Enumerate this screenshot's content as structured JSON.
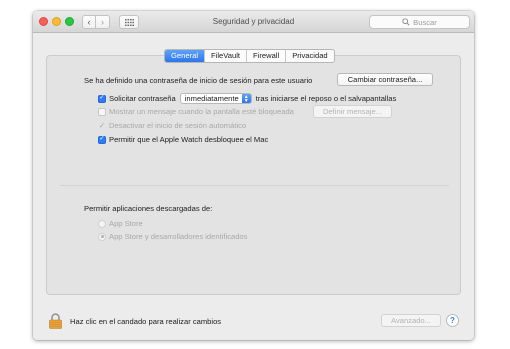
{
  "window": {
    "title": "Seguridad y privacidad"
  },
  "toolbar": {
    "back_icon": "chevron-left-icon",
    "forward_icon": "chevron-right-icon",
    "grid_icon": "show-all-grid-icon",
    "search_placeholder": "Buscar"
  },
  "tabs": [
    {
      "label": "General",
      "active": true
    },
    {
      "label": "FileVault",
      "active": false
    },
    {
      "label": "Firewall",
      "active": false
    },
    {
      "label": "Privacidad",
      "active": false
    }
  ],
  "general": {
    "password_set_text": "Se ha definido una contraseña de inicio de sesión para este usuario",
    "change_password_button": "Cambiar contraseña...",
    "require_password": {
      "label": "Solicitar contraseña",
      "checked": true,
      "popup_value": "inmediatamente",
      "suffix": "tras iniciarse el reposo o el salvapantallas"
    },
    "show_message": {
      "label": "Mostrar un mensaje cuando la pantalla esté bloqueada",
      "checked": false,
      "enabled": false,
      "button": "Definir mensaje..."
    },
    "disable_autologin": {
      "label": "Desactivar el inicio de sesión automático",
      "checked": true,
      "enabled": false
    },
    "apple_watch": {
      "label": "Permitir que el Apple Watch desbloquee el Mac",
      "checked": true
    }
  },
  "downloads": {
    "heading": "Permitir aplicaciones descargadas de:",
    "options": [
      {
        "label": "App Store",
        "selected": false
      },
      {
        "label": "App Store y desarrolladores identificados",
        "selected": true
      }
    ]
  },
  "footer": {
    "lock_text": "Haz clic en el candado para realizar cambios",
    "advanced_button": "Avanzado...",
    "help_label": "?"
  },
  "colors": {
    "accent": "#2f7cf6",
    "lock": "#e9a23b"
  }
}
